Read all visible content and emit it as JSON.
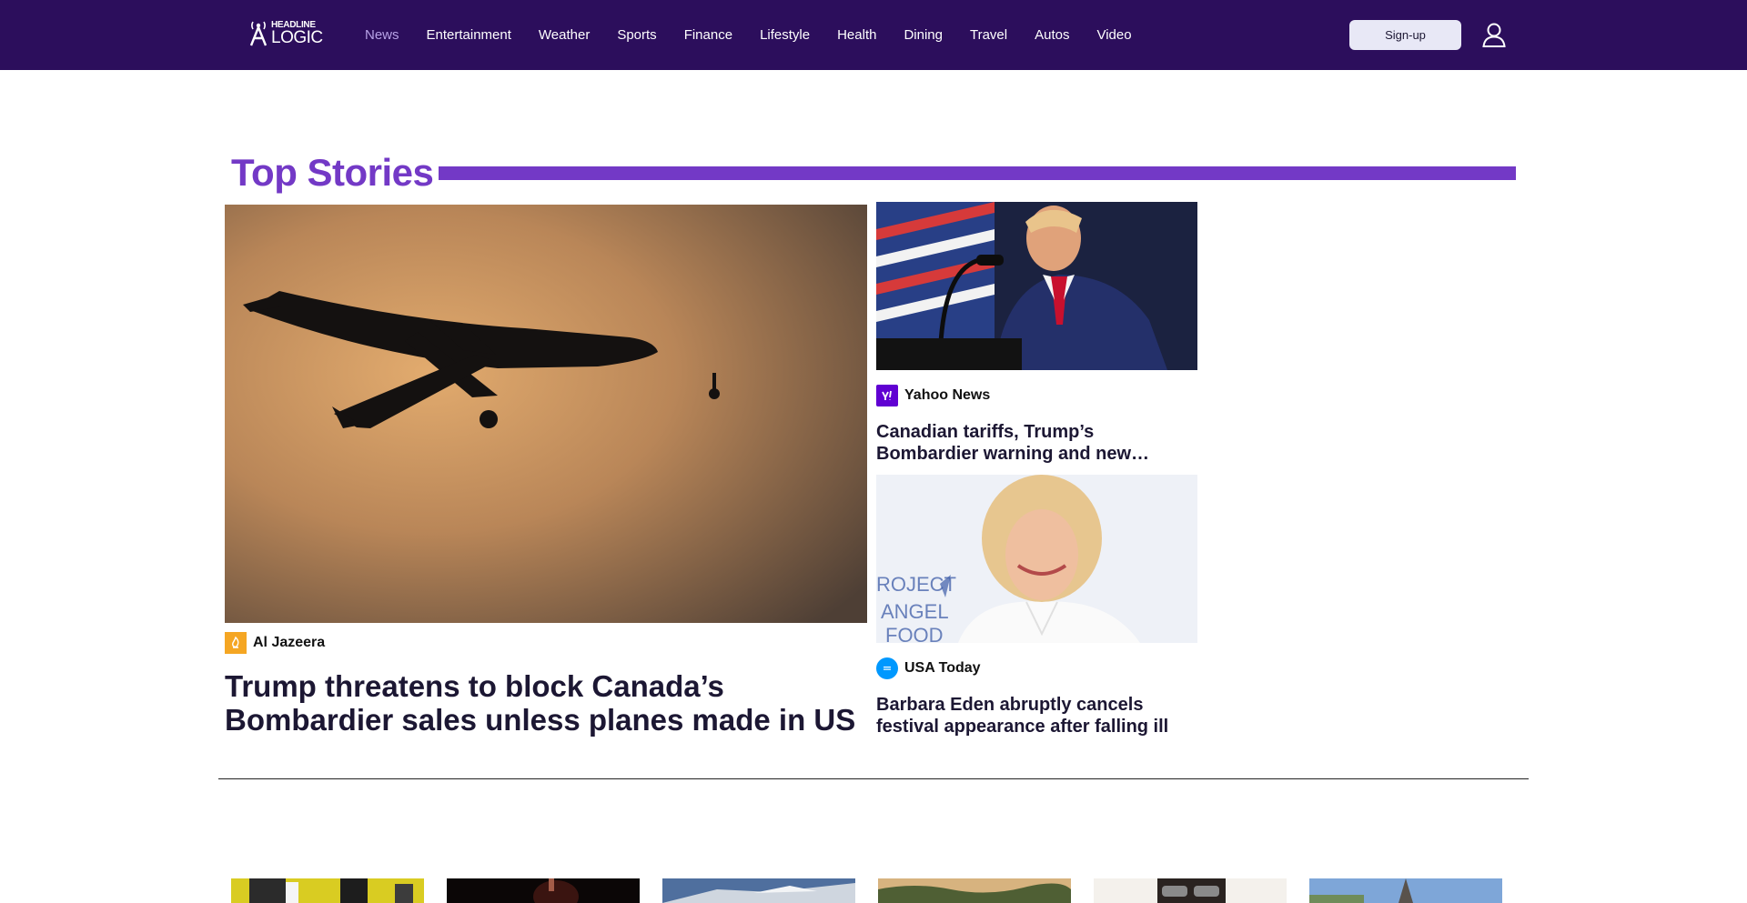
{
  "header": {
    "logo_top": "HEADLINE",
    "logo_bottom": "LOGIC",
    "nav": [
      "News",
      "Entertainment",
      "Weather",
      "Sports",
      "Finance",
      "Lifestyle",
      "Health",
      "Dining",
      "Travel",
      "Autos",
      "Video"
    ],
    "active_nav": "News",
    "signup_label": "Sign-up",
    "user_icon": "user-icon"
  },
  "top_stories": {
    "title": "Top Stories",
    "accent_color": "#7339c6",
    "main": {
      "source": "Al Jazeera",
      "source_icon": "al-jazeera-logo",
      "headline": "Trump threatens to block Canada’s Bombardier sales unless planes made in US",
      "image": "plane-silhouette-photo"
    },
    "side": [
      {
        "source": "Yahoo News",
        "source_icon": "yahoo-logo",
        "headline": "Canadian tariffs, Trump’s Bombardier warning and new…",
        "image": "trump-podium-photo"
      },
      {
        "source": "USA Today",
        "source_icon": "usa-today-logo",
        "headline": "Barbara Eden abruptly cancels festival appearance after falling ill",
        "image": "barbara-eden-photo"
      }
    ]
  },
  "more_stories": {
    "thumbnails": [
      "football-photo",
      "concert-photo",
      "mountain-photo",
      "lake-photo",
      "portrait-photo",
      "eiffel-tower-photo"
    ]
  },
  "colors": {
    "header_bg": "#2c0e5c",
    "nav_active": "#b7a2e6",
    "headline": "#1c1733"
  }
}
